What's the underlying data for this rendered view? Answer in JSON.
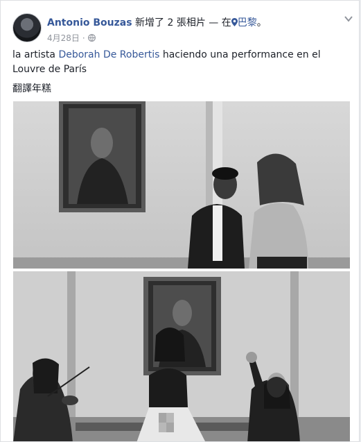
{
  "post": {
    "author": "Antonio Bouzas",
    "action": "新增了 2 張相片 — 在",
    "location": "巴黎",
    "location_suffix": "。",
    "date": "4月28日",
    "dot": "·",
    "text_before": "la artista ",
    "text_link": "Deborah De Robertis",
    "text_after": " haciendo una performance en el Louvre de París",
    "translate_label": "翻譯年糕"
  },
  "icons": {
    "avatar": "profile-photo",
    "pin": "map-pin-icon",
    "privacy": "globe-icon",
    "menu": "chevron-down-icon"
  },
  "colors": {
    "link": "#365899",
    "text": "#1d2129",
    "meta": "#90949c",
    "page_bg": "#e9ebee"
  },
  "photos": [
    {
      "content": "black-and-white photo of Mona Lisa gallery with two women"
    },
    {
      "content": "black-and-white photo of performance in front of Mona Lisa"
    }
  ]
}
